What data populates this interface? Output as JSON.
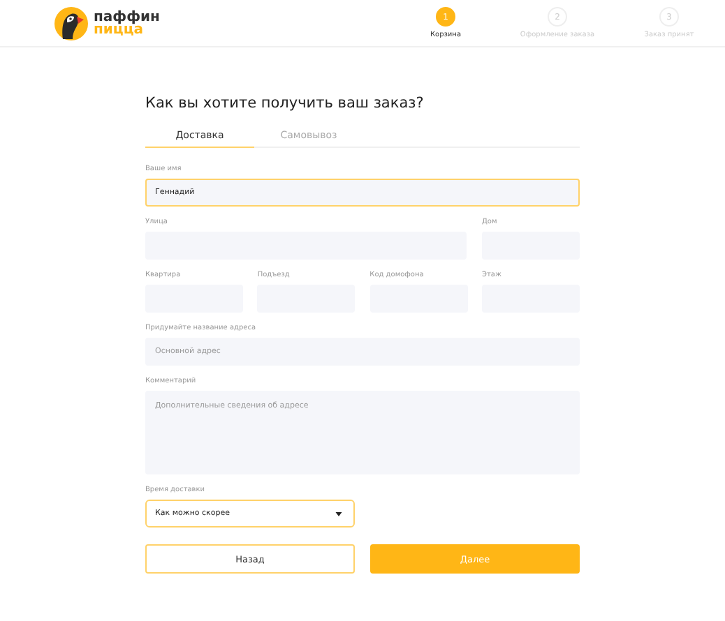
{
  "header": {
    "logo": {
      "line1": "паффин",
      "line2": "пицца"
    },
    "steps": [
      {
        "number": "1",
        "label": "Корзина",
        "selected": true
      },
      {
        "number": "2",
        "label": "Оформление заказа",
        "selected": false
      },
      {
        "number": "3",
        "label": "Заказ принят",
        "selected": false
      }
    ]
  },
  "form": {
    "title": "Как вы хотите получить ваш заказ?",
    "tabs": [
      {
        "label": "Доставка",
        "selected": true
      },
      {
        "label": "Самовывоз",
        "selected": false
      }
    ],
    "rows": [
      {
        "kind": "full",
        "fields": [
          {
            "kind": "text",
            "label": "Ваше имя",
            "value": "Геннадий",
            "highlighted": true
          }
        ]
      },
      {
        "kind": "wide-narrow",
        "fields": [
          {
            "kind": "text",
            "label": "Улица",
            "highlighted": false
          },
          {
            "kind": "text",
            "label": "Дом",
            "highlighted": false
          }
        ]
      },
      {
        "kind": "quarters",
        "fields": [
          {
            "kind": "text",
            "label": "Квартира",
            "highlighted": false
          },
          {
            "kind": "text",
            "label": "Подъезд",
            "highlighted": false
          },
          {
            "kind": "text",
            "label": "Код домофона",
            "highlighted": false
          },
          {
            "kind": "text",
            "label": "Этаж",
            "highlighted": false
          }
        ]
      },
      {
        "kind": "full",
        "fields": [
          {
            "kind": "text",
            "label": "Придумайте название адреса",
            "placeholder": "Основной адрес",
            "highlighted": false
          }
        ]
      },
      {
        "kind": "full",
        "fields": [
          {
            "kind": "textarea",
            "label": "Комментарий",
            "placeholder": "Дополнительные сведения об адресе",
            "highlighted": false
          }
        ]
      },
      {
        "kind": "half",
        "fields": [
          {
            "kind": "select",
            "label": "Время доставки",
            "value": "Как можно скорее",
            "highlighted": true
          }
        ]
      }
    ],
    "buttons": [
      {
        "kind": "secondary",
        "label": "Назад"
      },
      {
        "kind": "primary",
        "label": "Далее"
      }
    ]
  }
}
